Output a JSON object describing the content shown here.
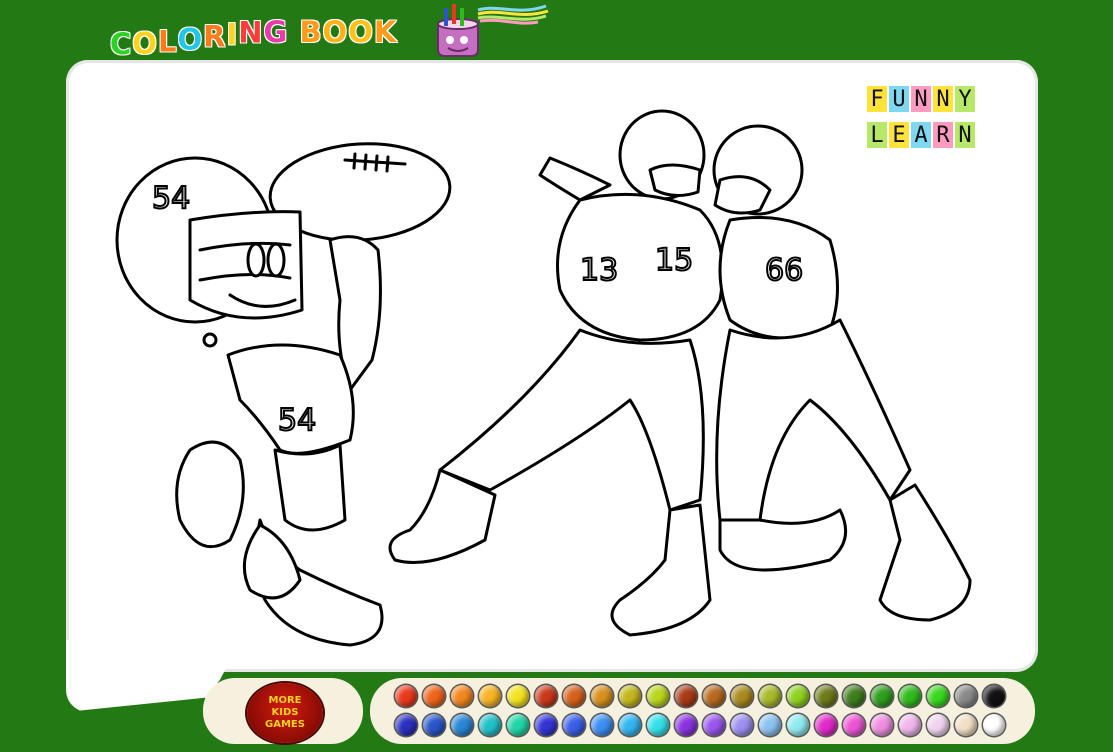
{
  "title": {
    "letters": [
      {
        "ch": "C",
        "color": "#2bd124"
      },
      {
        "ch": "O",
        "color": "#ffd21f"
      },
      {
        "ch": "L",
        "color": "#ff7a1a"
      },
      {
        "ch": "O",
        "color": "#22c7e8"
      },
      {
        "ch": "R",
        "color": "#ff7a1a"
      },
      {
        "ch": "I",
        "color": "#ffd21f"
      },
      {
        "ch": "N",
        "color": "#ff3b3b"
      },
      {
        "ch": "G",
        "color": "#e83ba8"
      },
      {
        "ch": " ",
        "color": "#ffffff"
      },
      {
        "ch": "B",
        "color": "#ff9a1a"
      },
      {
        "ch": "O",
        "color": "#ffb31a"
      },
      {
        "ch": "O",
        "color": "#ffc21a"
      },
      {
        "ch": "K",
        "color": "#ff9a1a"
      }
    ]
  },
  "logo": {
    "icon": "paint-bucket-icon"
  },
  "funny_learn": {
    "rows": [
      [
        {
          "ch": "F",
          "bg": "#ffe23a"
        },
        {
          "ch": "U",
          "bg": "#7fd8f2"
        },
        {
          "ch": "N",
          "bg": "#ff9bc0"
        },
        {
          "ch": "N",
          "bg": "#ffe23a"
        },
        {
          "ch": "Y",
          "bg": "#b7e86a"
        }
      ],
      [
        {
          "ch": "L",
          "bg": "#b7e86a"
        },
        {
          "ch": "E",
          "bg": "#ffe23a"
        },
        {
          "ch": "A",
          "bg": "#7fd8f2"
        },
        {
          "ch": "R",
          "bg": "#ff9bc0"
        },
        {
          "ch": "N",
          "bg": "#b7e86a"
        }
      ]
    ]
  },
  "drawing": {
    "subject": "football-players-coloring-page",
    "numbers": [
      "54",
      "54",
      "13",
      "15",
      "66"
    ]
  },
  "more_button": {
    "line1": "MORE",
    "line2": "KIDS",
    "line3": "GAMES"
  },
  "palette": {
    "row1": [
      "#e8391c",
      "#f0641c",
      "#f2871e",
      "#f5b423",
      "#f4e21f",
      "#c9381b",
      "#d6611e",
      "#d7901f",
      "#c3b61d",
      "#b9d61c",
      "#a83b16",
      "#b7691f",
      "#aa8a1f",
      "#a9b92b",
      "#8fd11f",
      "#6f7a1a",
      "#3e7d1c",
      "#2f9d1d",
      "#30bb1c",
      "#38d81f",
      "#8a8a8a",
      "#111111"
    ],
    "row2": [
      "#2b2fbf",
      "#2a55c9",
      "#2a86d4",
      "#22c0c9",
      "#1fd6a6",
      "#3333d6",
      "#3a5fe8",
      "#3b8ff2",
      "#34b6f0",
      "#33e0ea",
      "#8a33e0",
      "#9a55ee",
      "#9c8ff0",
      "#8cc2f2",
      "#8feaf0",
      "#e229c9",
      "#ec55d4",
      "#ef8ee0",
      "#f0b6ec",
      "#f2d4f0",
      "#f2dfc4",
      "#ffffff"
    ]
  }
}
